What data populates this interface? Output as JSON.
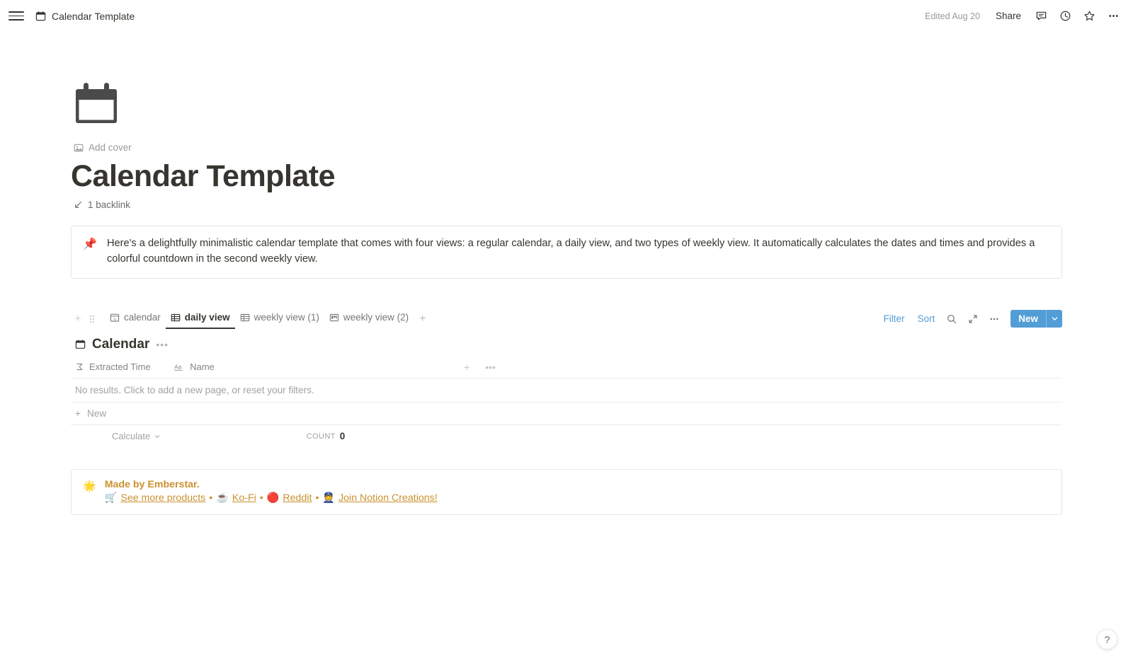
{
  "topbar": {
    "breadcrumb_title": "Calendar Template",
    "breadcrumb_icon": "calendar-icon",
    "edited": "Edited Aug 20",
    "share_label": "Share",
    "icons": [
      "comment-icon",
      "clock-history-icon",
      "star-icon",
      "more-options-icon"
    ]
  },
  "page": {
    "emoji_icon": "calendar-page-icon",
    "add_cover_label": "Add cover",
    "add_cover_icon": "image-icon",
    "title": "Calendar Template",
    "backlink_label": "1 backlink",
    "backlink_icon": "arrow-down-left-icon"
  },
  "callout": {
    "icon": "📌",
    "icon_name": "pushpin-icon",
    "text": "Here's a delightfully minimalistic calendar template that comes with four views: a regular calendar, a daily view, and two types of weekly view.  It automatically calculates the dates and times and provides a colorful countdown in the second weekly view."
  },
  "database": {
    "toolbar": {
      "add_block_icon": "plus-icon",
      "drag_handle_icon": "drag-handle-icon",
      "add_view_icon": "plus-icon",
      "filter_label": "Filter",
      "sort_label": "Sort",
      "search_icon": "search-icon",
      "expand_icon": "expand-icon",
      "more_icon": "more-options-icon",
      "new_label": "New",
      "new_chevron_icon": "chevron-down-icon",
      "accent_color": "#529dd6"
    },
    "views": [
      {
        "label": "calendar",
        "icon": "calendar-view-icon",
        "active": false
      },
      {
        "label": "daily view",
        "icon": "table-view-icon",
        "active": true
      },
      {
        "label": "weekly view (1)",
        "icon": "table-view-icon",
        "active": false
      },
      {
        "label": "weekly view (2)",
        "icon": "board-view-icon",
        "active": false
      }
    ],
    "title": "Calendar",
    "title_icon": "calendar-icon",
    "title_menu_icon": "more-options-icon",
    "columns": [
      {
        "label": "Extracted Time",
        "icon": "formula-icon"
      },
      {
        "label": "Name",
        "icon": "title-text-icon"
      }
    ],
    "add_column_icon": "plus-icon",
    "column_more_icon": "more-options-icon",
    "empty_message": "No results. Click to add a new page, or reset your filters.",
    "new_row_label": "New",
    "new_row_icon": "plus-icon",
    "footer": {
      "calculate_label": "Calculate",
      "calculate_chevron_icon": "chevron-down-icon",
      "count_label": "COUNT",
      "count_value": "0"
    }
  },
  "footer_callout": {
    "icon": "🌟",
    "icon_name": "shooting-star-icon",
    "title": "Made by Emberstar.",
    "accent_color": "#cb912f",
    "links": [
      {
        "emoji": "🛒",
        "emoji_name": "shopping-cart-icon",
        "label": "See more products"
      },
      {
        "emoji": "☕",
        "emoji_name": "coffee-icon",
        "label": "Ko-Fi"
      },
      {
        "emoji": "🔴",
        "emoji_name": "red-circle-icon",
        "label": "Reddit"
      },
      {
        "emoji": "👮",
        "emoji_name": "officer-icon",
        "label": "Join Notion Creations!"
      }
    ],
    "separator": "•"
  },
  "help": {
    "label": "?",
    "icon_name": "help-icon"
  }
}
